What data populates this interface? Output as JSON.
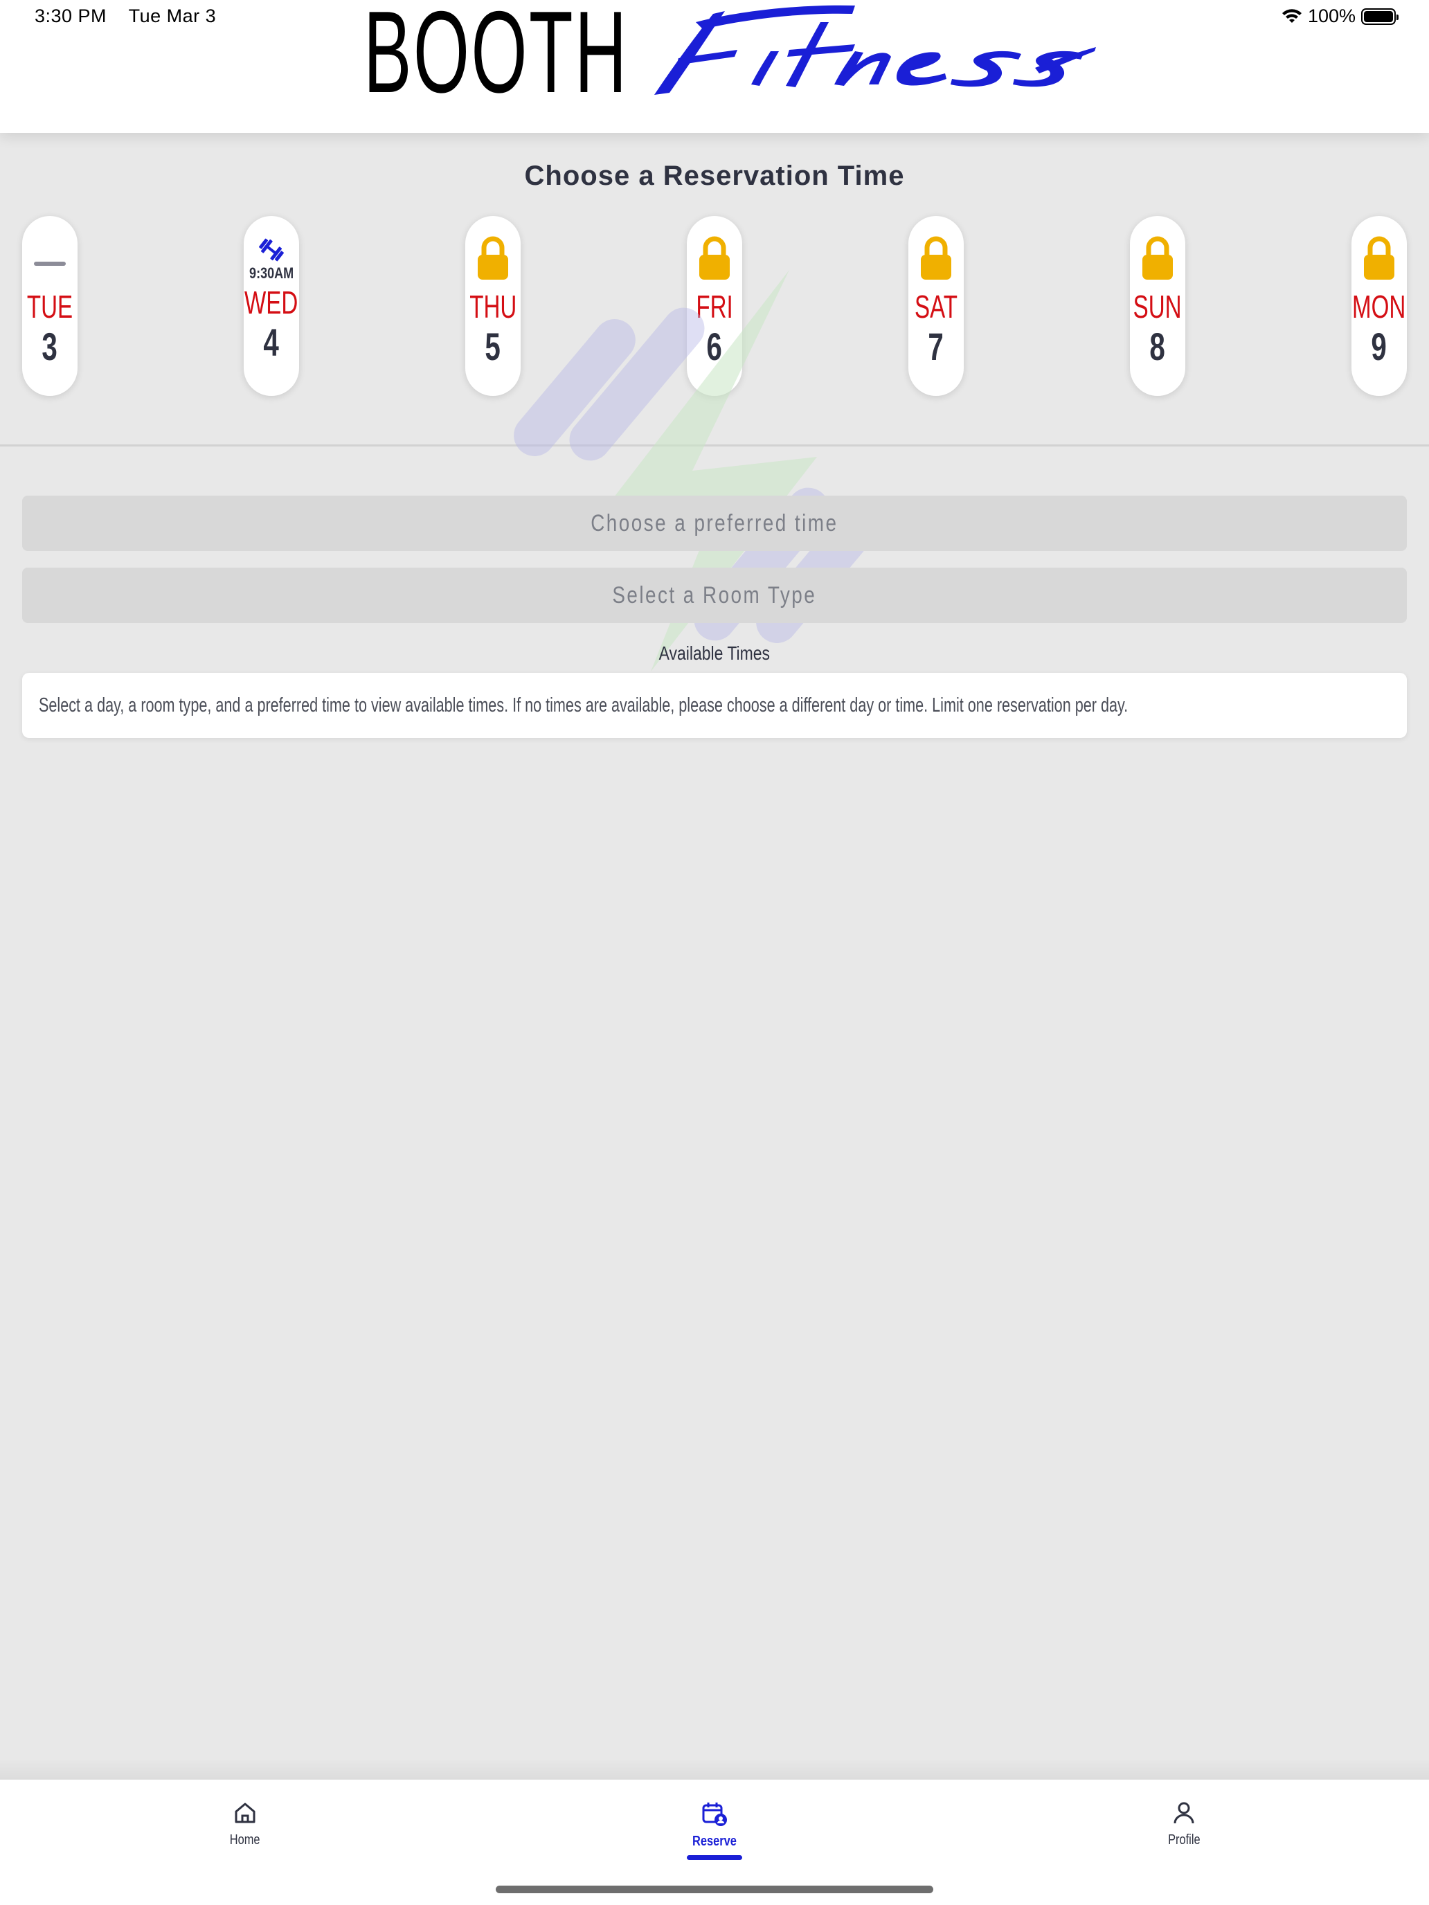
{
  "status_bar": {
    "time": "3:30 PM",
    "date": "Tue Mar 3",
    "battery": "100%",
    "icons": [
      "wifi-icon",
      "battery-icon"
    ]
  },
  "header": {
    "logo_word_1": "BOOTH",
    "logo_word_2": "Fitness",
    "colors": {
      "logo_script": "#1a1fd6",
      "logo_block": "#000000"
    }
  },
  "page": {
    "title": "Choose a Reservation Time"
  },
  "days": [
    {
      "name": "TUE",
      "num": "3",
      "indicator": "dash-icon",
      "time": ""
    },
    {
      "name": "WED",
      "num": "4",
      "indicator": "dumbbell-icon",
      "time": "9:30AM"
    },
    {
      "name": "THU",
      "num": "5",
      "indicator": "lock-icon",
      "time": ""
    },
    {
      "name": "FRI",
      "num": "6",
      "indicator": "lock-icon",
      "time": ""
    },
    {
      "name": "SAT",
      "num": "7",
      "indicator": "lock-icon",
      "time": ""
    },
    {
      "name": "SUN",
      "num": "8",
      "indicator": "lock-icon",
      "time": ""
    },
    {
      "name": "MON",
      "num": "9",
      "indicator": "lock-icon",
      "time": ""
    }
  ],
  "selectors": {
    "preferred_time": "Choose a preferred time",
    "room_type": "Select a Room Type"
  },
  "available": {
    "label": "Available Times",
    "message": "Select a day, a room type, and a preferred time to view available times. If no times are available, please choose a different day or time. Limit one reservation per day."
  },
  "tabs": [
    {
      "label": "Home",
      "icon": "home-icon",
      "active": false
    },
    {
      "label": "Reserve",
      "icon": "calendar-user-icon",
      "active": true
    },
    {
      "label": "Profile",
      "icon": "user-icon",
      "active": false
    }
  ],
  "colors": {
    "day_name": "#d40e14",
    "lock": "#f0b000",
    "accent": "#1a1fd6",
    "background": "#e8e8e8"
  }
}
